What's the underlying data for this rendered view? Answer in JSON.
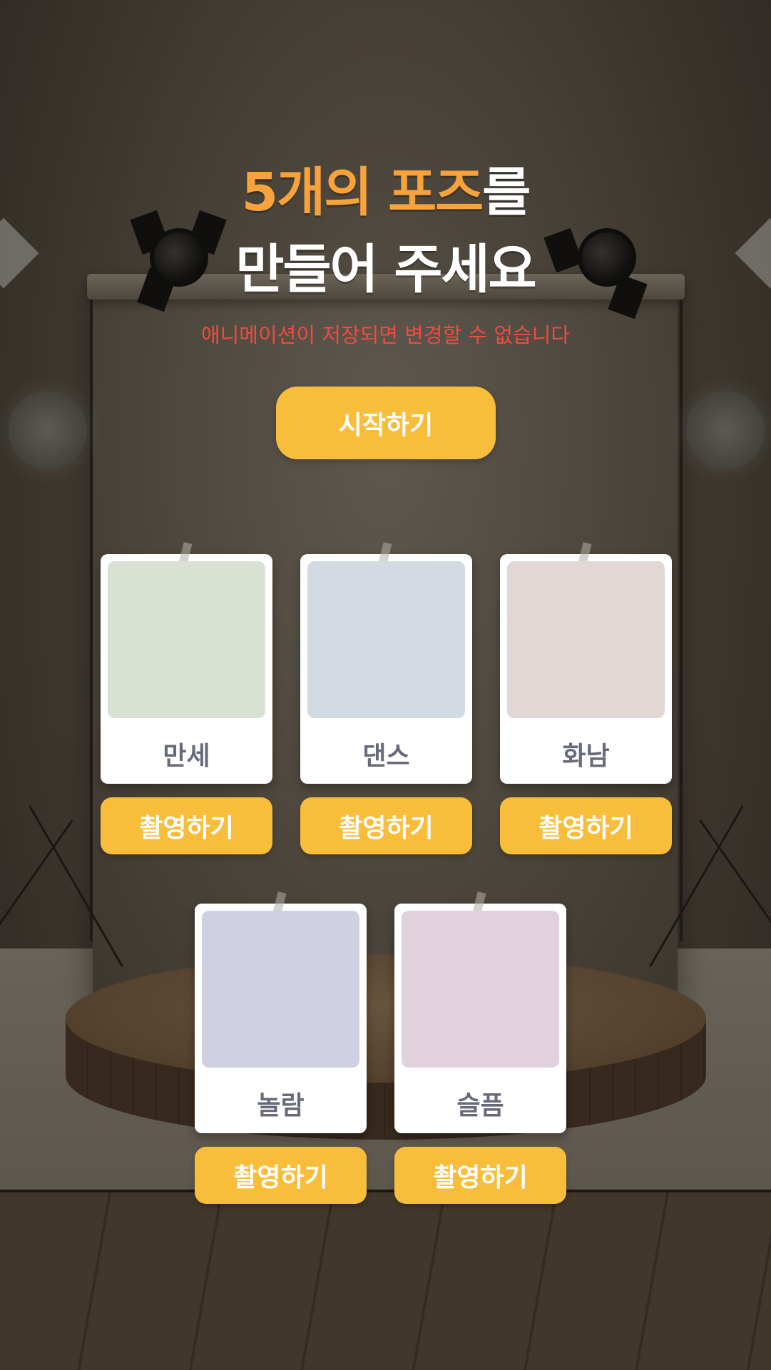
{
  "header": {
    "title_accent": "5개의 포즈",
    "title_rest": "를",
    "title_line2": "만들어 주세요",
    "subtitle": "애니메이션이 저장되면 변경할 수 없습니다"
  },
  "start_button": {
    "label": "시작하기"
  },
  "poses": [
    {
      "label": "만세",
      "button": "촬영하기",
      "thumb_color": "#d8e1d3"
    },
    {
      "label": "댄스",
      "button": "촬영하기",
      "thumb_color": "#d3dae2"
    },
    {
      "label": "화남",
      "button": "촬영하기",
      "thumb_color": "#e2d7d4"
    },
    {
      "label": "놀람",
      "button": "촬영하기",
      "thumb_color": "#cfd1e2"
    },
    {
      "label": "슬픔",
      "button": "촬영하기",
      "thumb_color": "#e1d1dc"
    }
  ],
  "colors": {
    "accent_orange": "#f7a23b",
    "button_yellow": "#f9bd3c",
    "warning_red": "#f04b40",
    "label_gray": "#666a7a"
  }
}
